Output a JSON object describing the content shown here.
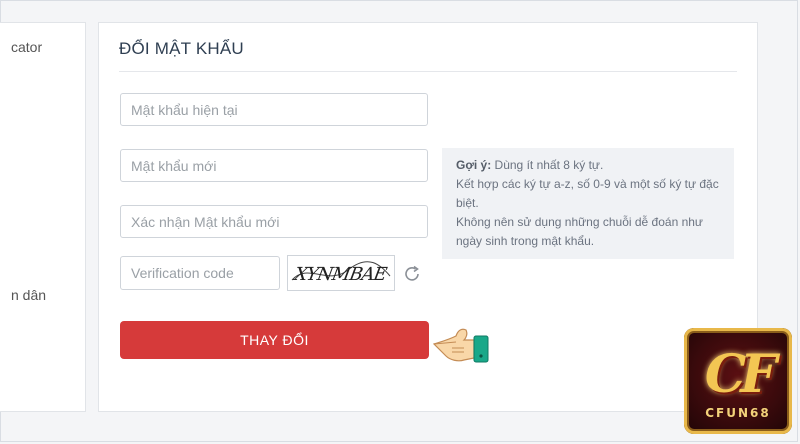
{
  "sidebar": {
    "items": [
      {
        "label": "cator"
      },
      {
        "label": "n dân"
      }
    ]
  },
  "form": {
    "title": "ĐỔI MẬT KHẨU",
    "current_password_placeholder": "Mật khẩu hiện tại",
    "new_password_placeholder": "Mật khẩu mới",
    "confirm_password_placeholder": "Xác nhận Mật khẩu mới",
    "verification_placeholder": "Verification code",
    "captcha_text": "XYNMBAE",
    "submit_label": "THAY ĐỔI"
  },
  "hint": {
    "label": "Gợi ý:",
    "line1": "Dùng ít nhất 8 ký tự.",
    "line2": "Kết hợp các ký tự a-z, số 0-9 và một số ký tự đặc biệt.",
    "line3": "Không nên sử dụng những chuỗi dễ đoán như ngày sinh trong mật khẩu."
  },
  "logo": {
    "glyph": "CF",
    "text": "CFUN68"
  },
  "colors": {
    "accent": "#d63a3a",
    "hint_bg": "#f0f2f5",
    "title": "#2f3f52"
  },
  "icons": [
    "refresh-icon",
    "pointing-hand-icon"
  ]
}
